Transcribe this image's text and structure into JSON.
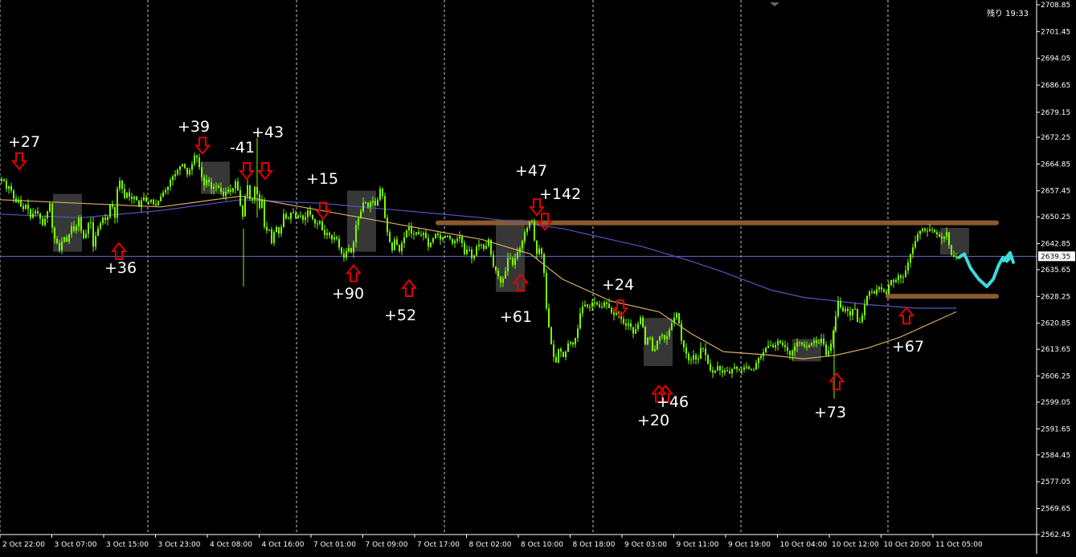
{
  "status": {
    "remaining_label": "残り 19:33",
    "current_price": "2639.35"
  },
  "colors": {
    "background": "#000000",
    "candles": "#7CFC00",
    "ma_fast": "#d8b060",
    "ma_slow": "#5555c8",
    "price_line": "#6a6acc",
    "zone_lines": "#8a5a2e",
    "arrows": "#e00000",
    "forecast": "#3fd9d9",
    "boxes": "#4a4a4a",
    "grid": "#ffffff",
    "axis_text": "#ffffff"
  },
  "chart_data": {
    "type": "candlestick",
    "title": "",
    "xlabel": "",
    "ylabel": "",
    "ylim": [
      2562.45,
      2708.85
    ],
    "y_ticks": [
      "2708.85",
      "2701.45",
      "2694.05",
      "2686.65",
      "2679.15",
      "2672.25",
      "2664.85",
      "2657.45",
      "2650.25",
      "2642.85",
      "2635.65",
      "2628.25",
      "2620.85",
      "2613.65",
      "2606.25",
      "2599.05",
      "2591.65",
      "2584.45",
      "2577.05",
      "2569.65",
      "2562.45"
    ],
    "x_ticks": [
      "2 Oct 22:00",
      "3 Oct 07:00",
      "3 Oct 15:00",
      "3 Oct 23:00",
      "4 Oct 08:00",
      "4 Oct 16:00",
      "7 Oct 01:00",
      "7 Oct 09:00",
      "7 Oct 17:00",
      "8 Oct 02:00",
      "8 Oct 10:00",
      "8 Oct 18:00",
      "9 Oct 03:00",
      "9 Oct 11:00",
      "9 Oct 19:00",
      "10 Oct 04:00",
      "10 Oct 12:00",
      "10 Oct 20:00",
      "11 Oct 05:00"
    ],
    "current_price": 2639.35,
    "price_path": [
      [
        0,
        2660
      ],
      [
        6,
        2661
      ],
      [
        10,
        2658
      ],
      [
        14,
        2659
      ],
      [
        18,
        2656
      ],
      [
        21,
        2654
      ],
      [
        25,
        2655
      ],
      [
        30,
        2652
      ],
      [
        35,
        2654
      ],
      [
        40,
        2650
      ],
      [
        45,
        2652
      ],
      [
        50,
        2651
      ],
      [
        55,
        2648
      ],
      [
        60,
        2651
      ],
      [
        64,
        2654
      ],
      [
        68,
        2645
      ],
      [
        73,
        2643
      ],
      [
        76,
        2641
      ],
      [
        81,
        2645
      ],
      [
        86,
        2643
      ],
      [
        90,
        2648
      ],
      [
        95,
        2646
      ],
      [
        100,
        2650
      ],
      [
        105,
        2644
      ],
      [
        110,
        2646
      ],
      [
        114,
        2651
      ],
      [
        118,
        2642
      ],
      [
        122,
        2646
      ],
      [
        126,
        2648
      ],
      [
        130,
        2650
      ],
      [
        135,
        2649
      ],
      [
        140,
        2655
      ],
      [
        145,
        2650
      ],
      [
        148,
        2658
      ],
      [
        152,
        2661
      ],
      [
        156,
        2655
      ],
      [
        160,
        2657
      ],
      [
        165,
        2655
      ],
      [
        170,
        2656
      ],
      [
        175,
        2653
      ],
      [
        180,
        2656
      ],
      [
        185,
        2654
      ],
      [
        190,
        2655
      ],
      [
        195,
        2653
      ],
      [
        200,
        2655
      ],
      [
        205,
        2657
      ],
      [
        210,
        2658
      ],
      [
        215,
        2661
      ],
      [
        220,
        2662
      ],
      [
        225,
        2664
      ],
      [
        230,
        2665
      ],
      [
        235,
        2662
      ],
      [
        240,
        2664
      ],
      [
        245,
        2668
      ],
      [
        248,
        2666
      ],
      [
        252,
        2662
      ],
      [
        256,
        2659
      ],
      [
        260,
        2661
      ],
      [
        265,
        2658
      ],
      [
        270,
        2659
      ],
      [
        275,
        2658
      ],
      [
        280,
        2656
      ],
      [
        285,
        2658
      ],
      [
        290,
        2657
      ],
      [
        295,
        2660
      ],
      [
        300,
        2656
      ],
      [
        303,
        2648
      ],
      [
        306,
        2655
      ],
      [
        310,
        2659
      ],
      [
        314,
        2654
      ],
      [
        318,
        2656
      ],
      [
        320,
        2661
      ],
      [
        324,
        2652
      ],
      [
        328,
        2655
      ],
      [
        332,
        2645
      ],
      [
        336,
        2648
      ],
      [
        340,
        2643
      ],
      [
        345,
        2648
      ],
      [
        350,
        2645
      ],
      [
        355,
        2651
      ],
      [
        360,
        2649
      ],
      [
        365,
        2652
      ],
      [
        370,
        2650
      ],
      [
        375,
        2651
      ],
      [
        380,
        2649
      ],
      [
        385,
        2652
      ],
      [
        390,
        2650
      ],
      [
        395,
        2648
      ],
      [
        400,
        2649
      ],
      [
        405,
        2645
      ],
      [
        410,
        2646
      ],
      [
        415,
        2644
      ],
      [
        420,
        2645
      ],
      [
        425,
        2641
      ],
      [
        430,
        2639
      ],
      [
        435,
        2642
      ],
      [
        440,
        2640
      ],
      [
        445,
        2648
      ],
      [
        450,
        2651
      ],
      [
        455,
        2655
      ],
      [
        460,
        2653
      ],
      [
        465,
        2655
      ],
      [
        470,
        2653
      ],
      [
        475,
        2658
      ],
      [
        478,
        2656
      ],
      [
        482,
        2648
      ],
      [
        486,
        2644
      ],
      [
        490,
        2641
      ],
      [
        494,
        2645
      ],
      [
        498,
        2640
      ],
      [
        502,
        2643
      ],
      [
        506,
        2645
      ],
      [
        510,
        2648
      ],
      [
        515,
        2645
      ],
      [
        520,
        2646
      ],
      [
        525,
        2645
      ],
      [
        530,
        2646
      ],
      [
        535,
        2642
      ],
      [
        540,
        2644
      ],
      [
        545,
        2646
      ],
      [
        550,
        2644
      ],
      [
        555,
        2645
      ],
      [
        560,
        2645
      ],
      [
        565,
        2643
      ],
      [
        570,
        2644
      ],
      [
        575,
        2645
      ],
      [
        580,
        2640
      ],
      [
        585,
        2642
      ],
      [
        590,
        2638
      ],
      [
        595,
        2642
      ],
      [
        600,
        2643
      ],
      [
        605,
        2641
      ],
      [
        610,
        2644
      ],
      [
        615,
        2637
      ],
      [
        620,
        2635
      ],
      [
        625,
        2632
      ],
      [
        630,
        2634
      ],
      [
        635,
        2640
      ],
      [
        640,
        2637
      ],
      [
        645,
        2640
      ],
      [
        650,
        2642
      ],
      [
        655,
        2646
      ],
      [
        660,
        2648
      ],
      [
        663,
        2651
      ],
      [
        666,
        2645
      ],
      [
        670,
        2640
      ],
      [
        674,
        2642
      ],
      [
        678,
        2638
      ],
      [
        682,
        2625
      ],
      [
        686,
        2618
      ],
      [
        690,
        2612
      ],
      [
        694,
        2610
      ],
      [
        698,
        2615
      ],
      [
        702,
        2611
      ],
      [
        706,
        2613
      ],
      [
        710,
        2616
      ],
      [
        715,
        2615
      ],
      [
        720,
        2618
      ],
      [
        725,
        2625
      ],
      [
        730,
        2626
      ],
      [
        735,
        2625
      ],
      [
        740,
        2627
      ],
      [
        745,
        2626
      ],
      [
        750,
        2625
      ],
      [
        755,
        2627
      ],
      [
        760,
        2625
      ],
      [
        765,
        2623
      ],
      [
        770,
        2624
      ],
      [
        775,
        2622
      ],
      [
        780,
        2620
      ],
      [
        785,
        2621
      ],
      [
        790,
        2618
      ],
      [
        795,
        2620
      ],
      [
        800,
        2623
      ],
      [
        805,
        2615
      ],
      [
        810,
        2618
      ],
      [
        815,
        2612
      ],
      [
        820,
        2616
      ],
      [
        825,
        2618
      ],
      [
        830,
        2616
      ],
      [
        835,
        2619
      ],
      [
        840,
        2622
      ],
      [
        845,
        2624
      ],
      [
        850,
        2616
      ],
      [
        855,
        2613
      ],
      [
        860,
        2610
      ],
      [
        865,
        2612
      ],
      [
        870,
        2610
      ],
      [
        875,
        2615
      ],
      [
        880,
        2612
      ],
      [
        885,
        2608
      ],
      [
        890,
        2607
      ],
      [
        895,
        2609
      ],
      [
        900,
        2607
      ],
      [
        905,
        2608
      ],
      [
        910,
        2607
      ],
      [
        915,
        2609
      ],
      [
        920,
        2608
      ],
      [
        925,
        2608
      ],
      [
        930,
        2609
      ],
      [
        935,
        2608
      ],
      [
        940,
        2608
      ],
      [
        945,
        2611
      ],
      [
        950,
        2612
      ],
      [
        955,
        2614
      ],
      [
        960,
        2615
      ],
      [
        965,
        2614
      ],
      [
        970,
        2616
      ],
      [
        975,
        2615
      ],
      [
        980,
        2614
      ],
      [
        985,
        2612
      ],
      [
        990,
        2614
      ],
      [
        995,
        2616
      ],
      [
        1000,
        2615
      ],
      [
        1005,
        2614
      ],
      [
        1010,
        2615
      ],
      [
        1015,
        2616
      ],
      [
        1020,
        2615
      ],
      [
        1025,
        2617
      ],
      [
        1030,
        2612
      ],
      [
        1035,
        2614
      ],
      [
        1040,
        2620
      ],
      [
        1045,
        2627
      ],
      [
        1050,
        2624
      ],
      [
        1055,
        2625
      ],
      [
        1060,
        2623
      ],
      [
        1065,
        2626
      ],
      [
        1070,
        2620
      ],
      [
        1075,
        2623
      ],
      [
        1080,
        2628
      ],
      [
        1085,
        2630
      ],
      [
        1090,
        2629
      ],
      [
        1095,
        2631
      ],
      [
        1100,
        2630
      ],
      [
        1105,
        2629
      ],
      [
        1110,
        2633
      ],
      [
        1115,
        2632
      ],
      [
        1120,
        2634
      ],
      [
        1125,
        2633
      ],
      [
        1130,
        2636
      ],
      [
        1135,
        2640
      ],
      [
        1140,
        2643
      ],
      [
        1145,
        2646
      ],
      [
        1150,
        2647
      ],
      [
        1155,
        2646
      ],
      [
        1160,
        2647
      ],
      [
        1165,
        2646
      ],
      [
        1170,
        2645
      ],
      [
        1175,
        2644
      ],
      [
        1180,
        2646
      ],
      [
        1185,
        2640
      ],
      [
        1190,
        2639
      ]
    ],
    "ma_fast_path": [
      [
        0,
        2655
      ],
      [
        100,
        2654
      ],
      [
        200,
        2653
      ],
      [
        300,
        2656
      ],
      [
        400,
        2652
      ],
      [
        500,
        2648
      ],
      [
        600,
        2644
      ],
      [
        660,
        2640
      ],
      [
        700,
        2633
      ],
      [
        760,
        2627
      ],
      [
        820,
        2624
      ],
      [
        860,
        2618
      ],
      [
        900,
        2613
      ],
      [
        960,
        2612
      ],
      [
        1000,
        2611
      ],
      [
        1040,
        2612
      ],
      [
        1080,
        2614
      ],
      [
        1120,
        2617
      ],
      [
        1160,
        2621
      ],
      [
        1190,
        2624
      ]
    ],
    "ma_slow_path": [
      [
        0,
        2651
      ],
      [
        100,
        2650
      ],
      [
        200,
        2652
      ],
      [
        300,
        2655
      ],
      [
        400,
        2654
      ],
      [
        500,
        2652
      ],
      [
        600,
        2650
      ],
      [
        700,
        2647
      ],
      [
        800,
        2642
      ],
      [
        860,
        2638
      ],
      [
        900,
        2635
      ],
      [
        960,
        2630
      ],
      [
        1000,
        2628
      ],
      [
        1040,
        2627
      ],
      [
        1080,
        2626
      ],
      [
        1140,
        2625
      ],
      [
        1190,
        2625
      ]
    ],
    "zones": [
      {
        "x_from": 545,
        "x_to": 1240,
        "price": 2648.6
      },
      {
        "x_from": 1105,
        "x_to": 1240,
        "price": 2628.3
      }
    ],
    "forecast_path": [
      [
        1193,
        2639
      ],
      [
        1200,
        2640
      ],
      [
        1208,
        2636
      ],
      [
        1218,
        2633
      ],
      [
        1228,
        2631
      ],
      [
        1236,
        2633
      ],
      [
        1243,
        2637
      ],
      [
        1248,
        2639
      ],
      [
        1253,
        2638
      ],
      [
        1257,
        2639
      ]
    ],
    "boxes": [
      {
        "x": 66,
        "w": 36,
        "y_top": 2656.6,
        "y_bot": 2640.6
      },
      {
        "x": 250,
        "w": 36,
        "y_top": 2665.5,
        "y_bot": 2656.6
      },
      {
        "x": 432,
        "w": 36,
        "y_top": 2657.5,
        "y_bot": 2640.6
      },
      {
        "x": 617,
        "w": 36,
        "y_top": 2649.5,
        "y_bot": 2629.5
      },
      {
        "x": 801,
        "w": 36,
        "y_top": 2622.3,
        "y_bot": 2609.0
      },
      {
        "x": 986,
        "w": 36,
        "y_top": 2616.5,
        "y_bot": 2610.3
      },
      {
        "x": 1170,
        "w": 36,
        "y_top": 2647.2,
        "y_bot": 2639.8
      }
    ],
    "arrows": [
      {
        "dir": "down",
        "x": 24,
        "price": 2665.2
      },
      {
        "dir": "up",
        "x": 148,
        "price": 2641.2
      },
      {
        "dir": "down",
        "x": 252,
        "price": 2669.5
      },
      {
        "dir": "down",
        "x": 307,
        "price": 2662.5
      },
      {
        "dir": "down",
        "x": 330,
        "price": 2662.5
      },
      {
        "dir": "down",
        "x": 402,
        "price": 2651.5
      },
      {
        "dir": "up",
        "x": 440,
        "price": 2635.1
      },
      {
        "dir": "up",
        "x": 509,
        "price": 2631.0
      },
      {
        "dir": "up",
        "x": 648,
        "price": 2632.5
      },
      {
        "dir": "down",
        "x": 668,
        "price": 2652.5
      },
      {
        "dir": "down",
        "x": 678,
        "price": 2648.5
      },
      {
        "dir": "down",
        "x": 772,
        "price": 2624.5
      },
      {
        "dir": "up",
        "x": 820,
        "price": 2601.8
      },
      {
        "dir": "up",
        "x": 828,
        "price": 2601.8
      },
      {
        "dir": "up",
        "x": 1041,
        "price": 2605.2
      },
      {
        "dir": "up",
        "x": 1128,
        "price": 2623.4
      }
    ],
    "annotations": [
      {
        "text": "+27",
        "x": 10,
        "y": 183
      },
      {
        "text": "+36",
        "x": 130,
        "y": 340
      },
      {
        "text": "+39",
        "x": 221,
        "y": 164
      },
      {
        "text": "-41",
        "x": 286,
        "y": 190
      },
      {
        "text": "+43",
        "x": 313,
        "y": 171
      },
      {
        "text": "+15",
        "x": 381,
        "y": 229
      },
      {
        "text": "+90",
        "x": 413,
        "y": 372
      },
      {
        "text": "+52",
        "x": 478,
        "y": 399
      },
      {
        "text": "+47",
        "x": 641,
        "y": 219
      },
      {
        "text": "+142",
        "x": 671,
        "y": 248
      },
      {
        "text": "+61",
        "x": 622,
        "y": 401
      },
      {
        "text": "+24",
        "x": 749,
        "y": 361
      },
      {
        "text": "+46",
        "x": 817,
        "y": 507
      },
      {
        "text": "+20",
        "x": 793,
        "y": 530
      },
      {
        "text": "+73",
        "x": 1013,
        "y": 520
      },
      {
        "text": "+67",
        "x": 1110,
        "y": 438
      }
    ]
  }
}
